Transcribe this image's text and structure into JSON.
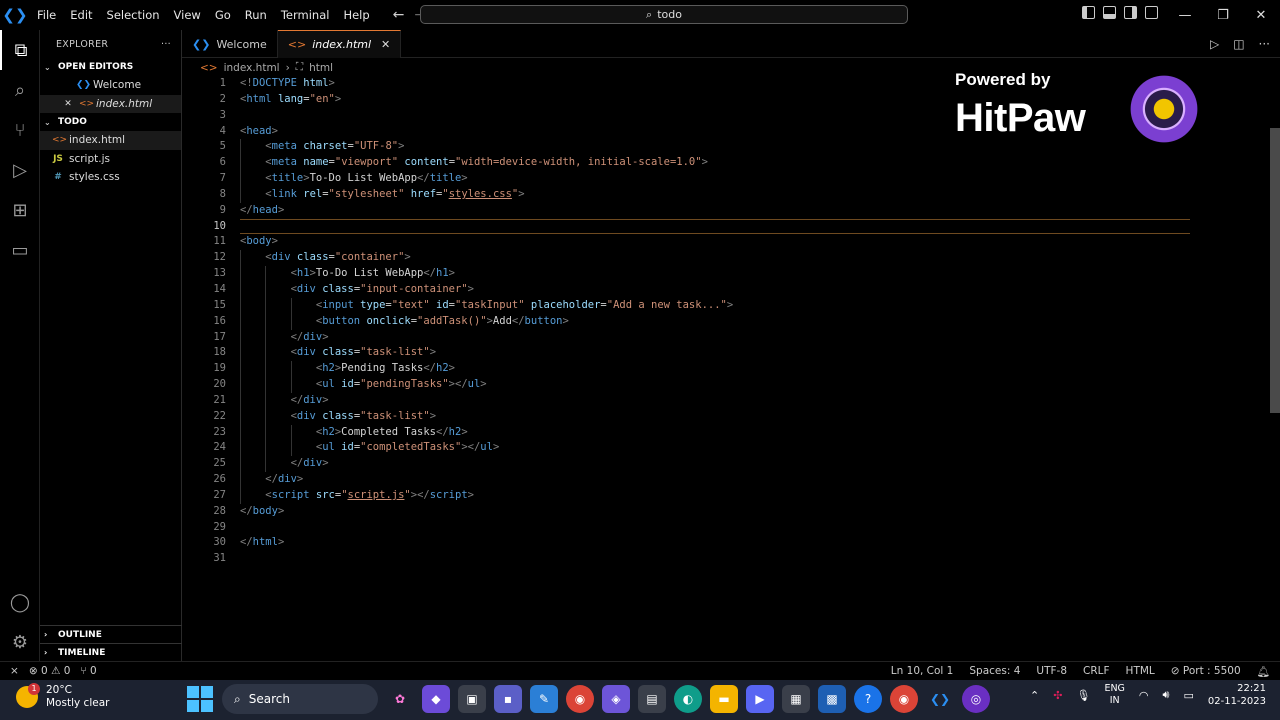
{
  "menu": [
    "File",
    "Edit",
    "Selection",
    "View",
    "Go",
    "Run",
    "Terminal",
    "Help"
  ],
  "command_center": {
    "text": "todo"
  },
  "explorer": {
    "title": "EXPLORER",
    "more": "···",
    "open_editors_label": "OPEN EDITORS",
    "open_editors": [
      {
        "name": "Welcome",
        "icon": "vscode-icon"
      },
      {
        "name": "index.html",
        "icon": "html-icon"
      }
    ],
    "folder_label": "TODO",
    "files": [
      {
        "name": "index.html",
        "icon_text": "<>"
      },
      {
        "name": "script.js",
        "icon_text": "JS"
      },
      {
        "name": "styles.css",
        "icon_text": "#"
      }
    ],
    "outline_label": "OUTLINE",
    "timeline_label": "TIMELINE"
  },
  "tabs": [
    {
      "label": "Welcome"
    },
    {
      "label": "index.html"
    }
  ],
  "breadcrumb": {
    "file": "index.html",
    "symbol": "html"
  },
  "editor": {
    "current_line": 10
  },
  "watermark": {
    "powered": "Powered by",
    "brand": "HitPaw"
  },
  "status": {
    "remote": "⨯",
    "problems": "⊗ 0 ⚠ 0",
    "ports": "⑂ 0",
    "position": "Ln 10, Col 1",
    "spaces": "Spaces: 4",
    "encoding": "UTF-8",
    "eol": "CRLF",
    "language": "HTML",
    "port": "⊘ Port : 5500"
  },
  "taskbar": {
    "temp": "20°C",
    "weather": "Mostly clear",
    "badge": "1",
    "search_label": "Search",
    "lang_top": "ENG",
    "lang_bottom": "IN",
    "time": "22:21",
    "date": "02-11-2023"
  },
  "colors": {
    "accent": "#e37933",
    "vscode_blue": "#2b8ff2",
    "tag": "#569cd6",
    "attr": "#9cdcfe",
    "string": "#ce9178"
  }
}
